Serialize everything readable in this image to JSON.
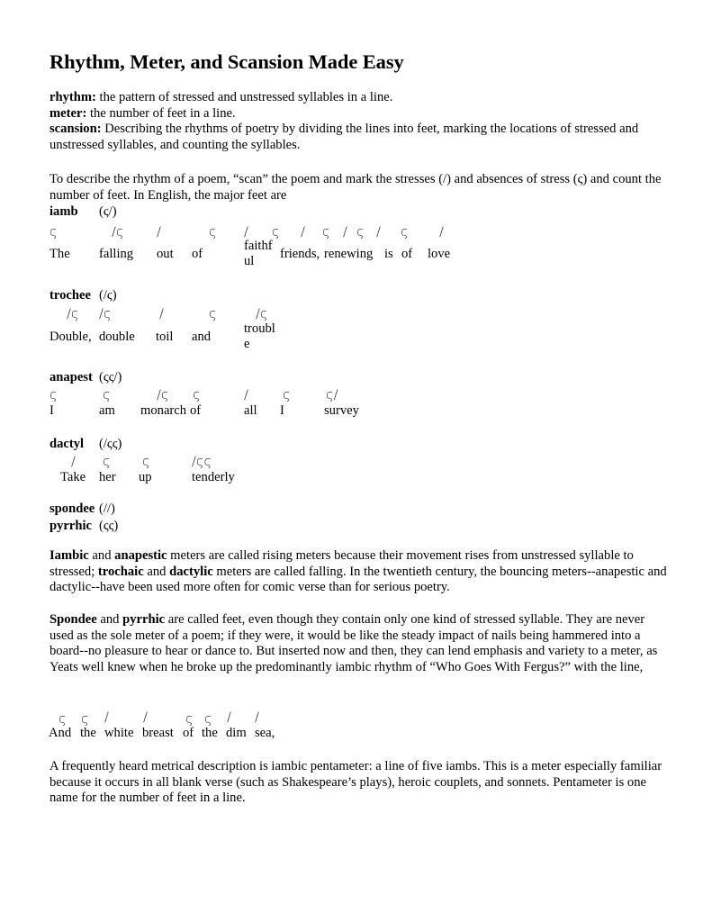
{
  "document": {
    "title": "Rhythm, Meter, and Scansion Made Easy",
    "definitions": [
      {
        "term": "rhythm:",
        "text": " the pattern of stressed and unstressed syllables in a line."
      },
      {
        "term": "meter:",
        "text": " the number of feet in a line."
      },
      {
        "term": "scansion:",
        "text": " Describing the rhythms of poetry by dividing the lines into feet, marking the locations of stressed and unstressed syllables, and counting the syllables."
      }
    ],
    "intro": "To describe the rhythm of a poem, “scan” the poem and mark the stresses (/) and absences of stress (ς) and count the number of feet. In English, the major feet are",
    "stress_mark": "/",
    "unstress_mark": "ς",
    "feet": {
      "iamb": {
        "name": "iamb",
        "pattern": "(ς/)",
        "example_marks": [
          "ς",
          "/ς",
          "/",
          "ς",
          "/",
          "ς",
          "/",
          "ς",
          "/",
          "ς",
          "/",
          "ς",
          "/"
        ],
        "example_words": [
          "The",
          "falling",
          "out",
          "of",
          "faithf\nul",
          "friends,",
          "renewing",
          "is",
          "of",
          "love"
        ]
      },
      "trochee": {
        "name": "trochee",
        "pattern": "(/ς)",
        "example_marks": [
          "/ς",
          "/ς",
          "/",
          "ς",
          "/ς"
        ],
        "example_words": [
          "Double,",
          "double",
          "toil",
          "and",
          "troubl\ne"
        ]
      },
      "anapest": {
        "name": "anapest",
        "pattern": "(ςς/)",
        "example_marks": [
          "ς",
          "ς",
          "/ς",
          "ς",
          "/",
          "ς",
          "ς/"
        ],
        "example_words": [
          "I",
          "am",
          "monarch",
          "of",
          "all",
          "I",
          "survey"
        ]
      },
      "dactyl": {
        "name": "dactyl",
        "pattern": "(/ςς)",
        "example_marks": [
          "/",
          "ς",
          "ς",
          "/ςς"
        ],
        "example_words": [
          "Take",
          "her",
          "up",
          "tenderly"
        ]
      },
      "spondee": {
        "name": "spondee",
        "pattern": "(//)"
      },
      "pyrrhic": {
        "name": "pyrrhic",
        "pattern": "(ςς)"
      }
    },
    "para_rising": {
      "b1": "Iambic",
      "t1": " and ",
      "b2": "anapestic",
      "t2": " meters are called rising meters because their movement rises from unstressed syllable to stressed; ",
      "b3": "trochaic",
      "t3": " and ",
      "b4": "dactylic",
      "t4": " meters are called falling. In the twentieth century, the bouncing meters--anapestic and dactylic--have been used more often for comic verse than for serious poetry."
    },
    "para_spondee": {
      "b1": "Spondee",
      "t1": " and ",
      "b2": "pyrrhic",
      "t2": " are called feet, even though they contain only one kind of stressed syllable. They are never used as the sole meter of a poem; if they were, it would be like the steady impact of nails being hammered into a board--no pleasure to hear or dance to. But inserted now and then, they can lend emphasis and variety to a meter, as Yeats well knew when he broke up the predominantly iambic rhythm of “Who Goes With Fergus?” with the line,"
    },
    "yeats_line": {
      "marks": [
        "ς",
        "ς",
        "/",
        "/",
        "ς",
        "ς",
        "/",
        "/"
      ],
      "words": [
        "And",
        "the",
        "white",
        "breast",
        "of",
        "the",
        "dim",
        "sea,"
      ]
    },
    "para_pentameter": "A frequently heard metrical description is iambic pentameter: a line of five iambs. This is a meter especially familiar because it occurs in all blank verse (such as Shakespeare’s plays), heroic couplets, and sonnets. Pentameter is one name for the number of feet in a line."
  }
}
